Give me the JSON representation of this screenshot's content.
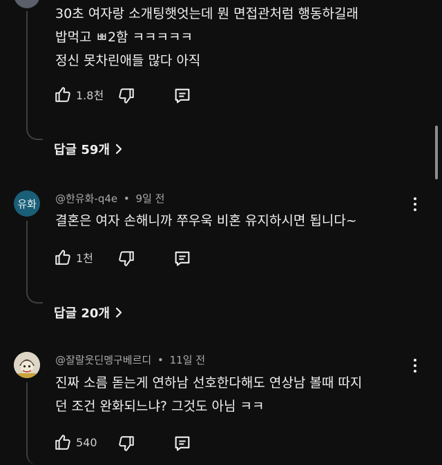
{
  "comments": [
    {
      "lines": [
        "30초 여자랑 소개팅햇엇는데 뭔 면접관처럼 행동하길래",
        "밥먹고 ㅃ2함 ㅋㅋㅋㅋㅋ",
        "정신 못차린애들 많다 아직"
      ],
      "likes": "1.8천",
      "replies_label": "답글 59개"
    },
    {
      "avatar_text": "유화",
      "author": "@한유화-q4e",
      "time": "9일 전",
      "lines": [
        "결혼은 여자 손해니까 쭈우욱 비혼 유지하시면 됩니다~"
      ],
      "likes": "1천",
      "replies_label": "답글 20개"
    },
    {
      "author": "@잘랄웃딘멩구베르디",
      "time": "11일 전",
      "lines": [
        "진짜 소름 돋는게 연하남 선호한다해도 연상남 볼때 따지",
        "던 조건 완화되느냐? 그것도 아님 ㅋㅋ"
      ],
      "likes": "540"
    }
  ],
  "meta_separator": "•",
  "icons": {
    "like": "thumbs-up-icon",
    "dislike": "thumbs-down-icon",
    "reply": "comment-reply-icon",
    "more": "more-vert-icon",
    "expand": "chevron-right-icon"
  }
}
